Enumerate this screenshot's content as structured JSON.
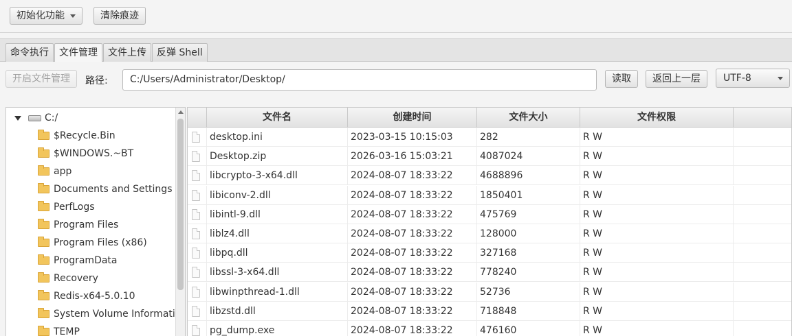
{
  "top_bar": {
    "init_menu_label": "初始化功能",
    "clear_traces_label": "清除痕迹"
  },
  "tabs": [
    {
      "label": "命令执行",
      "active": false
    },
    {
      "label": "文件管理",
      "active": true
    },
    {
      "label": "文件上传",
      "active": false
    },
    {
      "label": "反弹 Shell",
      "active": false
    }
  ],
  "toolbar": {
    "open_fm_label": "开启文件管理",
    "path_label": "路径:",
    "path_value": "C:/Users/Administrator/Desktop/",
    "read_label": "读取",
    "up_label": "返回上一层",
    "encoding": "UTF-8"
  },
  "tree": {
    "root": "C:/",
    "items": [
      "$Recycle.Bin",
      "$WINDOWS.~BT",
      "app",
      "Documents and Settings",
      "PerfLogs",
      "Program Files",
      "Program Files (x86)",
      "ProgramData",
      "Recovery",
      "Redis-x64-5.0.10",
      "System Volume Informati",
      "TEMP"
    ]
  },
  "table": {
    "columns": [
      "文件名",
      "创建时间",
      "文件大小",
      "文件权限"
    ],
    "rows": [
      {
        "name": "desktop.ini",
        "time": "2023-03-15 10:15:03",
        "size": "282",
        "perm": "R W"
      },
      {
        "name": "Desktop.zip",
        "time": "2026-03-16 15:03:21",
        "size": "4087024",
        "perm": "R W"
      },
      {
        "name": "libcrypto-3-x64.dll",
        "time": "2024-08-07 18:33:22",
        "size": "4688896",
        "perm": "R W"
      },
      {
        "name": "libiconv-2.dll",
        "time": "2024-08-07 18:33:22",
        "size": "1850401",
        "perm": "R W"
      },
      {
        "name": "libintl-9.dll",
        "time": "2024-08-07 18:33:22",
        "size": "475769",
        "perm": "R W"
      },
      {
        "name": "liblz4.dll",
        "time": "2024-08-07 18:33:22",
        "size": "128000",
        "perm": "R W"
      },
      {
        "name": "libpq.dll",
        "time": "2024-08-07 18:33:22",
        "size": "327168",
        "perm": "R W"
      },
      {
        "name": "libssl-3-x64.dll",
        "time": "2024-08-07 18:33:22",
        "size": "778240",
        "perm": "R W"
      },
      {
        "name": "libwinpthread-1.dll",
        "time": "2024-08-07 18:33:22",
        "size": "52736",
        "perm": "R W"
      },
      {
        "name": "libzstd.dll",
        "time": "2024-08-07 18:33:22",
        "size": "718848",
        "perm": "R W"
      },
      {
        "name": "pg_dump.exe",
        "time": "2024-08-07 18:33:22",
        "size": "476160",
        "perm": "R W"
      }
    ]
  }
}
